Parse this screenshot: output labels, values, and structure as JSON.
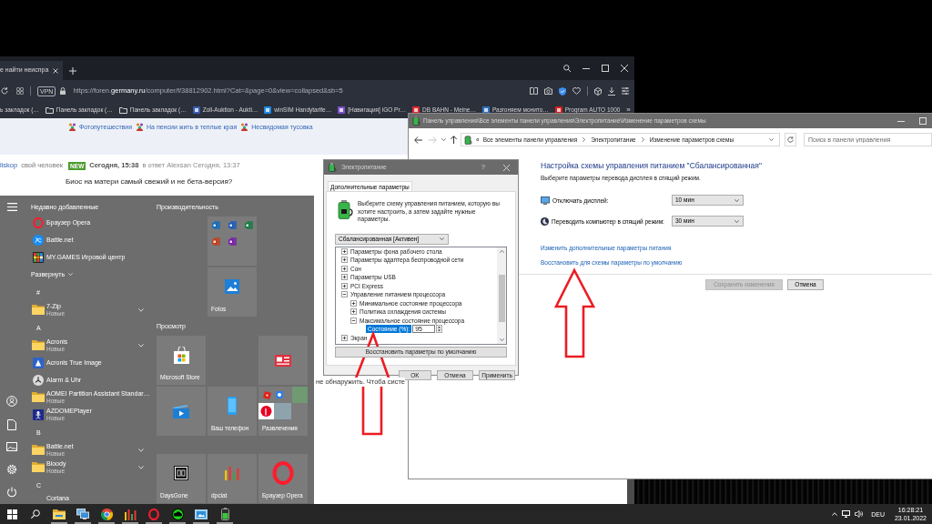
{
  "browser": {
    "tab": {
      "title": "е найти неиспра"
    },
    "vpn": "VPN",
    "url": {
      "prefix": "https://foren.",
      "host": "germany.ru",
      "path": "/computer/f/38812902.html?Cat=&page=0&view=collapsed&sb=5"
    },
    "bookmarks": [
      {
        "kind": "text",
        "label": "ь закладок (…"
      },
      {
        "kind": "folder",
        "label": "Панель закладок (…"
      },
      {
        "kind": "folder",
        "label": "Панель закладок (…"
      },
      {
        "kind": "favicon",
        "color": "#3a5bb0",
        "label": "Zoll-Auktion - Aukti…"
      },
      {
        "kind": "favicon",
        "color": "#1e88e5",
        "label": "winSIM Handytarife…"
      },
      {
        "kind": "favicon",
        "color": "#7b4fc9",
        "label": "[Навигация] iGO Pr…"
      },
      {
        "kind": "favicon",
        "color": "#e3262e",
        "label": "DB BAHN - Meine…"
      },
      {
        "kind": "favicon",
        "color": "#2f6fc0",
        "label": "Разгоняем монито…"
      },
      {
        "kind": "favicon",
        "color": "#d81e1e",
        "label": "Program AUTO 1000"
      }
    ],
    "bookmarks_more": "»",
    "page": {
      "forum_links": [
        "Фотопутешествия",
        "На пенсии жить в теплые края",
        "Несвидомая тусовка"
      ],
      "post": {
        "author": "liskop",
        "rank": "свой человек",
        "badge": "NEW",
        "time": "Сегодня, 15:38",
        "reply": "в ответ Alexsan Сегодня, 13:37",
        "text": "Биос на матери самый свежий и не бета-версия?"
      },
      "fragment": "не обнаружить. Чтоба систе"
    }
  },
  "start_menu": {
    "recent_header": "Недавно добавленные",
    "recent": [
      {
        "kind": "opera",
        "name": "Браузер Opera"
      },
      {
        "kind": "battlenet",
        "name": "Battle.net"
      },
      {
        "kind": "mygames",
        "name": "MY.GAMES Игровой центр"
      }
    ],
    "expand": "Развернуть",
    "sections": [
      {
        "letter": "#",
        "apps": [
          {
            "kind": "folder",
            "name": "7-Zip",
            "note": "Новые"
          }
        ]
      },
      {
        "letter": "A",
        "apps": [
          {
            "kind": "folder",
            "name": "Acronis",
            "note": "Новые"
          },
          {
            "kind": "acronis",
            "name": "Acronis True Image"
          },
          {
            "kind": "alarm",
            "name": "Alarm & Uhr"
          },
          {
            "kind": "folder",
            "name": "AOMEI Partition Assistant Standar…",
            "note": "Новые"
          },
          {
            "kind": "azdome",
            "name": "AZDOMEPlayer",
            "note": "Новые"
          }
        ]
      },
      {
        "letter": "B",
        "apps": [
          {
            "kind": "folder",
            "name": "Battle.net",
            "note": "Новые"
          },
          {
            "kind": "folder",
            "name": "Bloody",
            "note": "Новые"
          }
        ]
      },
      {
        "letter": "C",
        "apps": [
          {
            "kind": "plain",
            "name": "Cortana"
          }
        ]
      }
    ],
    "tile_groups": [
      {
        "title": "Производительность",
        "tiles": [
          {
            "kind": "office"
          },
          {
            "kind": "photos",
            "label": "Fotos"
          }
        ]
      },
      {
        "title": "Просмотр",
        "tiles": [
          {
            "kind": "store",
            "label": "Microsoft Store"
          },
          {
            "kind": "news"
          },
          {
            "kind": "movies"
          },
          {
            "kind": "phone",
            "label": "Ваш телефон"
          },
          {
            "kind": "games",
            "label": "Развлечения"
          }
        ]
      },
      {
        "tiles": [
          {
            "kind": "daysgone",
            "label": "DaysGone"
          },
          {
            "kind": "dpclat",
            "label": "dpclat"
          },
          {
            "kind": "opera",
            "label": "Браузер Opera"
          }
        ]
      }
    ]
  },
  "control_panel": {
    "title": "Панель управления\\Все элементы панели управления\\Электропитание\\Изменение параметров схемы",
    "navigation": {
      "forward_disabled": true
    },
    "overflow": "«",
    "breadcrumb": [
      "Все элементы панели управления",
      "Электропитание",
      "Изменение параметров схемы"
    ],
    "search": {
      "placeholder": "Поиск в панели управления"
    },
    "heading": "Настройка схемы управления питанием \"Сбалансированная\"",
    "description": "Выберите параметры перевода дисплея в спящий режим.",
    "settings": [
      {
        "kind": "display",
        "label": "Отключать дисплей:",
        "value": "10 мин"
      },
      {
        "kind": "sleep",
        "label": "Переводить компьютер в спящий режим:",
        "value": "30 мин"
      }
    ],
    "links": [
      "Изменить дополнительные параметры питания",
      "Восстановить для схемы параметры по умолчанию"
    ],
    "buttons": [
      {
        "label": "Сохранить изменения",
        "disabled": true
      },
      {
        "label": "Отмена",
        "disabled": false
      }
    ]
  },
  "power_dialog": {
    "title": "Электропитание",
    "help": "?",
    "tabs": [
      {
        "label": "Дополнительные параметры",
        "selected": true
      }
    ],
    "intro": "Выберите схему управления питанием, которую вы хотите настроить, а затем задайте нужные параметры.",
    "plan": "Сбалансированная [Активен]",
    "tree": [
      {
        "label": "Параметры фона рабочего стола",
        "expanded": false
      },
      {
        "label": "Параметры адаптера беспроводной сети",
        "expanded": false
      },
      {
        "label": "Сон",
        "expanded": false
      },
      {
        "label": "Параметры USB",
        "expanded": false
      },
      {
        "label": "PCI Express",
        "expanded": false
      },
      {
        "label": "Управление питанием процессора",
        "expanded": true,
        "children": [
          {
            "label": "Минимальное состояние процессора",
            "expanded": false
          },
          {
            "label": "Политика охлаждения системы",
            "expanded": false
          },
          {
            "label": "Максимальное состояние процессора",
            "expanded": true,
            "children": [
              {
                "kind": "setting",
                "label": "Состояние (%):",
                "value": "95",
                "selected": true
              }
            ]
          }
        ]
      },
      {
        "label": "Экран",
        "expanded": false
      }
    ],
    "restore": "Восстановить параметры по умолчанию",
    "buttons": [
      "OK",
      "Отмена",
      "Применить"
    ]
  },
  "taskbar": {
    "apps": [
      {
        "kind": "explorer",
        "running": true
      },
      {
        "kind": "computer",
        "running": true
      },
      {
        "kind": "chrome",
        "running": true
      },
      {
        "kind": "dpclat",
        "running": true
      },
      {
        "kind": "opera",
        "running": true
      },
      {
        "kind": "cloud",
        "running": true
      },
      {
        "kind": "photo",
        "running": true
      },
      {
        "kind": "battery",
        "running": true
      }
    ],
    "language": "DEU",
    "time": "16:28:21",
    "date": "23.01.2022"
  }
}
